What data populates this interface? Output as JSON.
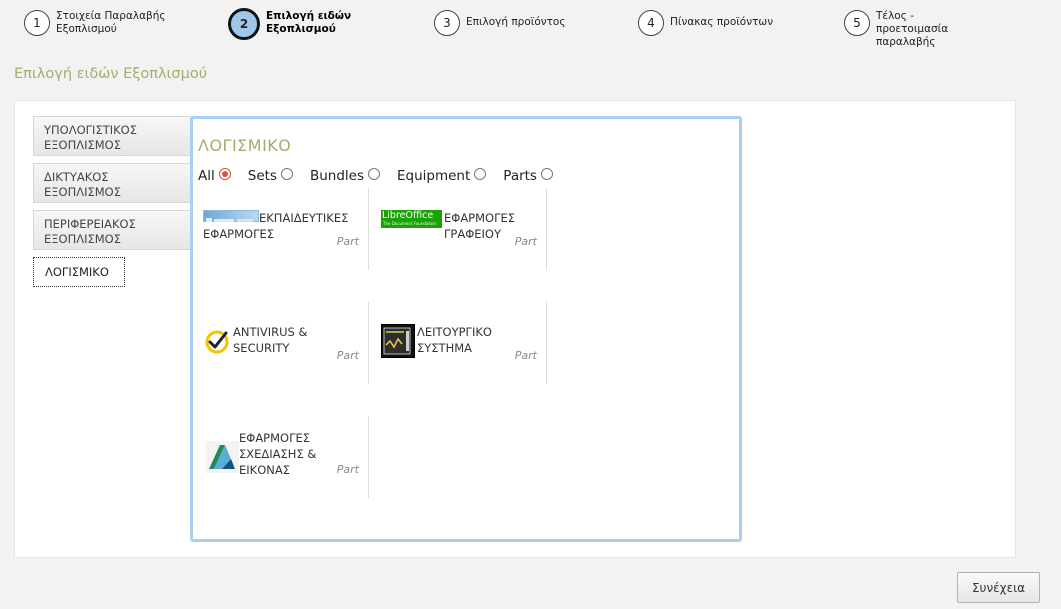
{
  "steps": [
    {
      "number": "1",
      "label": "Στοιχεία Παραλαβής Εξοπλισμού"
    },
    {
      "number": "2",
      "label": "Επιλογή ειδών Εξοπλισμού"
    },
    {
      "number": "3",
      "label": "Επιλογή προϊόντος"
    },
    {
      "number": "4",
      "label": "Πίνακας προϊόντων"
    },
    {
      "number": "5",
      "label": "Τέλος - προετοιμασία παραλαβής"
    }
  ],
  "active_step": 2,
  "page_title": "Επιλογή ειδών Εξοπλισμού",
  "tabs": [
    {
      "label": "ΥΠΟΛΟΓΙΣΤΙΚΟΣ ΕΞΟΠΛΙΣΜΟΣ"
    },
    {
      "label": "ΔΙΚΤΥΑΚΟΣ ΕΞΟΠΛΙΣΜΟΣ"
    },
    {
      "label": "ΠΕΡΙΦΕΡΕΙΑΚΟΣ ΕΞΟΠΛΙΣΜΟΣ"
    },
    {
      "label": "ΛΟΓΙΣΜΙΚΟ"
    }
  ],
  "selected_tab": "ΛΟΓΙΣΜΙΚΟ",
  "content": {
    "title": "ΛΟΓΙΣΜΙΚΟ",
    "filters": [
      {
        "label": "All",
        "checked": true
      },
      {
        "label": "Sets",
        "checked": false
      },
      {
        "label": "Bundles",
        "checked": false
      },
      {
        "label": "Equipment",
        "checked": false
      },
      {
        "label": "Parts",
        "checked": false
      }
    ],
    "items": [
      {
        "name": "ΕΚΠΑΙΔΕΥΤΙΚΕΣ ΕΦΑΡΜΟΓΕΣ",
        "type": "Part",
        "icon": "education-software-logo"
      },
      {
        "name": "ΕΦΑΡΜΟΓΕΣ ΓΡΑΦΕΙΟΥ",
        "type": "Part",
        "icon": "libreoffice-logo",
        "logo_text": "LibreOffice",
        "logo_subtext": "The Document Foundation"
      },
      {
        "name": "ANTIVIRUS & SECURITY",
        "type": "Part",
        "icon": "antivirus-checkmark-icon"
      },
      {
        "name": "ΛΕΙΤΟΥΡΓΙΚΟ ΣΥΣΤΗΜΑ",
        "type": "Part",
        "icon": "operating-system-icon"
      },
      {
        "name": "ΕΦΑΡΜΟΓΕΣ ΣΧΕΔΙΑΣΗΣ & ΕΙΚΟΝΑΣ",
        "type": "Part",
        "icon": "design-software-logo"
      }
    ]
  },
  "continue_label": "Συνέχεια",
  "colors": {
    "title_olive": "#a3ad6c",
    "content_border": "#a9cff2",
    "active_step_fill": "#9fc7ea",
    "radio_checked": "#e1503f"
  }
}
